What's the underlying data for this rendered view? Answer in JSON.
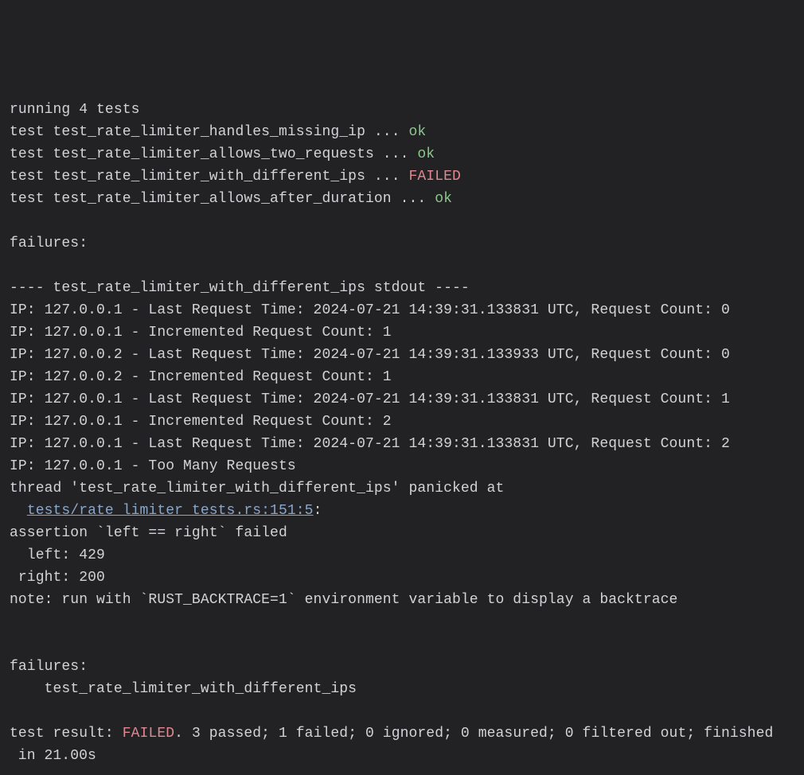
{
  "header": {
    "running": "running 4 tests"
  },
  "tests": [
    {
      "prefix": "test ",
      "name": "test_rate_limiter_handles_missing_ip",
      "mid": " ... ",
      "status": "ok",
      "status_class": "ok"
    },
    {
      "prefix": "test ",
      "name": "test_rate_limiter_allows_two_requests",
      "mid": " ... ",
      "status": "ok",
      "status_class": "ok"
    },
    {
      "prefix": "test ",
      "name": "test_rate_limiter_with_different_ips",
      "mid": " ... ",
      "status": "FAILED",
      "status_class": "fail"
    },
    {
      "prefix": "test ",
      "name": "test_rate_limiter_allows_after_duration",
      "mid": " ... ",
      "status": "ok",
      "status_class": "ok"
    }
  ],
  "failures_header": "failures:",
  "stdout_header": "---- test_rate_limiter_with_different_ips stdout ----",
  "stdout_lines": [
    "IP: 127.0.0.1 - Last Request Time: 2024-07-21 14:39:31.133831 UTC, Request Count: 0",
    "IP: 127.0.0.1 - Incremented Request Count: 1",
    "IP: 127.0.0.2 - Last Request Time: 2024-07-21 14:39:31.133933 UTC, Request Count: 0",
    "IP: 127.0.0.2 - Incremented Request Count: 1",
    "IP: 127.0.0.1 - Last Request Time: 2024-07-21 14:39:31.133831 UTC, Request Count: 1",
    "IP: 127.0.0.1 - Incremented Request Count: 2",
    "IP: 127.0.0.1 - Last Request Time: 2024-07-21 14:39:31.133831 UTC, Request Count: 2",
    "IP: 127.0.0.1 - Too Many Requests"
  ],
  "panic": {
    "line1": "thread 'test_rate_limiter_with_different_ips' panicked at ",
    "link_text": "tests/rate_limiter_tests.rs:151:5",
    "link_indent": "  ",
    "link_suffix": ":",
    "assert": "assertion `left == right` failed",
    "left": "  left: 429",
    "right": " right: 200",
    "note": "note: run with `RUST_BACKTRACE=1` environment variable to display a backtrace"
  },
  "failures_list": {
    "header": "failures:",
    "items": [
      "    test_rate_limiter_with_different_ips"
    ]
  },
  "result": {
    "prefix": "test result: ",
    "status": "FAILED",
    "suffix": ". 3 passed; 1 failed; 0 ignored; 0 measured; 0 filtered out; finished in 21.00s"
  }
}
